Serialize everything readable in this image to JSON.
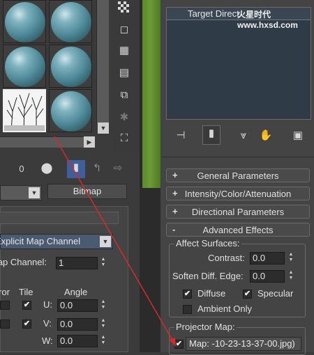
{
  "material_editor": {
    "slots": [
      {
        "name": "sphere"
      },
      {
        "name": "sphere"
      },
      {
        "name": "sphere"
      },
      {
        "name": "sphere"
      },
      {
        "name": "tree-bitmap"
      },
      {
        "name": "sphere"
      }
    ],
    "map_type_button": "Bitmap",
    "mapping_dropdown": "Explicit Map Channel",
    "map_channel_label": "Map Channel:",
    "map_channel_value": "1",
    "mirror_label": "Mirror",
    "tile_label": "Tile",
    "angle_label": "Angle",
    "u_label": "U:",
    "u_value": "0.0",
    "v_label": "V:",
    "v_value": "0.0",
    "w_label": "W:",
    "w_value": "0.0",
    "zero_label": "0"
  },
  "command_panel": {
    "list_header": "Target Direct",
    "watermark": "火星时代 www.hxsd.com",
    "rollouts": [
      {
        "sign": "+",
        "label": "General Parameters"
      },
      {
        "sign": "+",
        "label": "Intensity/Color/Attenuation"
      },
      {
        "sign": "+",
        "label": "Directional Parameters"
      },
      {
        "sign": "-",
        "label": "Advanced Effects"
      }
    ],
    "affect_surfaces": {
      "title": "Affect Surfaces:",
      "contrast_label": "Contrast:",
      "contrast_value": "0.0",
      "soften_label": "Soften Diff. Edge:",
      "soften_value": "0.0",
      "diffuse_label": "Diffuse",
      "specular_label": "Specular",
      "ambient_label": "Ambient Only"
    },
    "projector": {
      "title": "Projector Map:",
      "map_label": "Map: -10-23-13-37-00.jpg)"
    }
  },
  "colors": {
    "arrow": "#d62a2a",
    "viewport_green": "#5f8a2e",
    "panel": "#444444",
    "list_bg": "#2f3a45"
  }
}
